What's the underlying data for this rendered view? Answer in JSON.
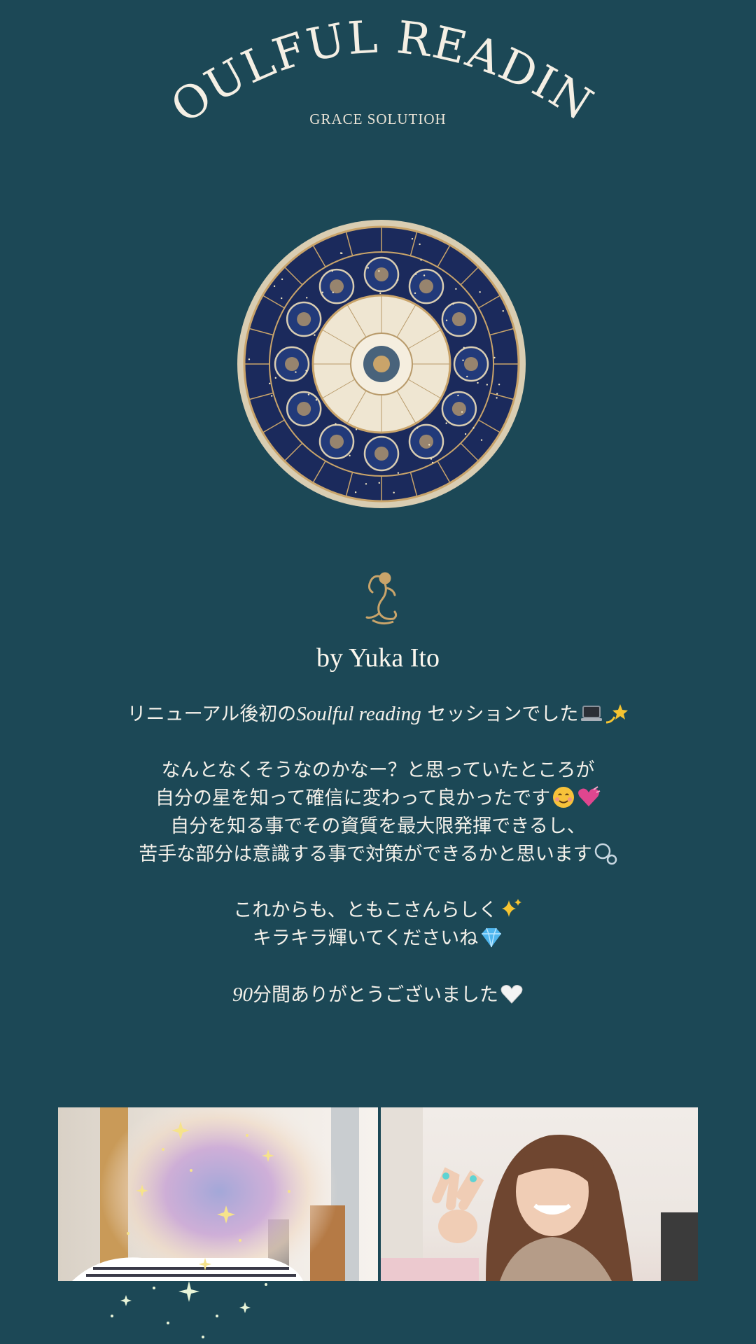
{
  "header": {
    "title": "SOULFUL READING",
    "subtitle": "GRACE SOLUTIOH"
  },
  "images": {
    "zodiac_wheel": "zodiac-wheel-illustration",
    "mermaid_logo": "mermaid-icon"
  },
  "author": "by Yuka Ito",
  "message": {
    "p1": {
      "before": "リニューアル後初の",
      "latin": "Soulful reading",
      "after": " セッションでした"
    },
    "p2": [
      "なんとなくそうなのかなー？と思っていたところが",
      "自分の星を知って確信に変わって良かったです",
      "自分を知る事でその資質を最大限発揮できるし、",
      "苦手な部分は意識する事で対策ができるかと思います"
    ],
    "p3": [
      "これからも、ともこさんらしく",
      "キラキラ輝いてくださいね"
    ],
    "p4": {
      "latin": "90",
      "after": "分間ありがとうございました"
    }
  },
  "emojis": [
    "laptop-icon",
    "dizzy-star-icon",
    "smiling-face-icon",
    "heart-icon",
    "bubbles-icon",
    "sparkles-icon",
    "gem-icon",
    "white-heart-icon"
  ],
  "colors": {
    "background": "#1c4856",
    "text": "#f4f1ea",
    "gold": "#c9a46a"
  }
}
